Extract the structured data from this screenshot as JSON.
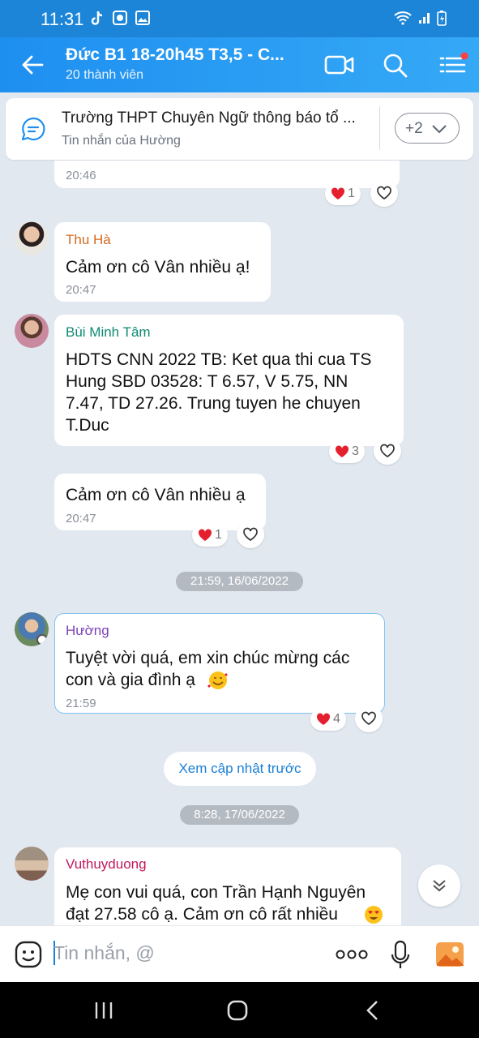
{
  "status_bar": {
    "time": "11:31"
  },
  "header": {
    "title": "Đức B1 18-20h45 T3,5 - C...",
    "subtitle": "20 thành viên",
    "accent": "#1e8ff0"
  },
  "pinned": {
    "text": "Trường THPT Chuyên Ngữ thông báo tổ ...",
    "sub": "Tin nhắn của Hường",
    "more_label": "+2"
  },
  "messages": [
    {
      "time": "20:46",
      "reaction_count": "1"
    },
    {
      "name": "Thu Hà",
      "text": "Cảm ơn cô Vân nhiều ạ!",
      "time": "20:47"
    },
    {
      "name": "Bùi Minh Tâm",
      "lines": [
        "HDTS CNN 2022 TB: Ket qua thi cua TS",
        "Hung SBD 03528: T 6.57, V 5.75, NN",
        "7.47, TD 27.26. Trung tuyen he chuyen",
        "T.Duc"
      ],
      "reaction_count": "3"
    },
    {
      "text": "Cảm ơn cô Vân nhiều ạ",
      "time": "20:47",
      "reaction_count": "1"
    },
    {
      "name": "Hường",
      "lines": [
        "Tuyệt vời quá, em xin chúc mừng các",
        "con và gia đình ạ"
      ],
      "time": "21:59",
      "reaction_count": "4"
    },
    {
      "name": "Vuthuyduong",
      "lines": [
        "Mẹ con vui quá, con Trần Hạnh Nguyên",
        "đạt 27.58 cô ạ. Cảm ơn cô rất nhiều"
      ]
    }
  ],
  "dates": [
    "21:59, 16/06/2022",
    "8:28, 17/06/2022"
  ],
  "view_previous": "Xem cập nhật trước",
  "composer": {
    "placeholder": "Tin nhắn, @"
  }
}
